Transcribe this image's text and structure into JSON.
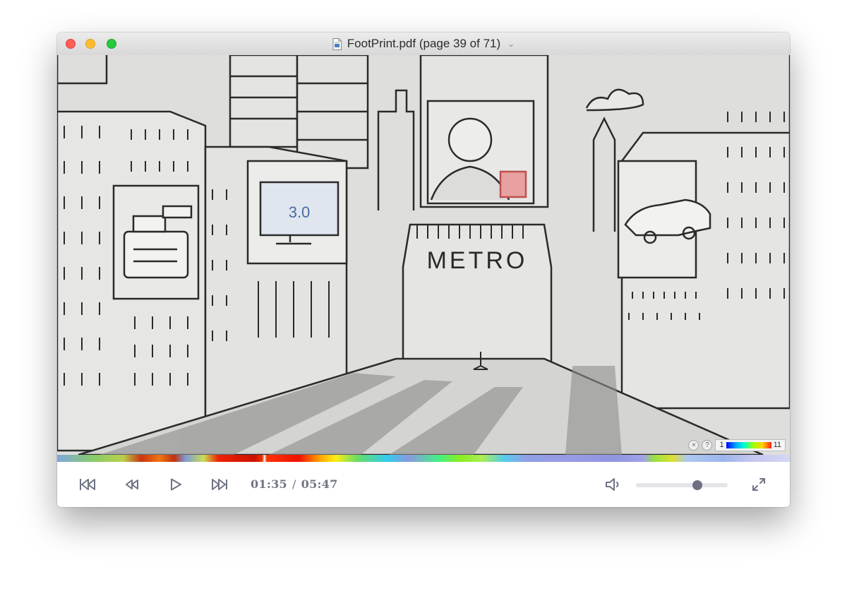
{
  "window": {
    "title": "FootPrint.pdf (page 39 of 71)"
  },
  "video": {
    "billboard_text": "3.0",
    "building_sign": "METRO",
    "heatmap_legend": {
      "min": "1",
      "max": "11",
      "close_symbol": "×",
      "help_symbol": "?"
    }
  },
  "controls": {
    "current_time": "01:35",
    "separator": "/",
    "total_time": "05:47",
    "volume_level": 0.67,
    "icons": [
      "skip-back-icon",
      "rewind-icon",
      "play-icon",
      "fast-forward-icon",
      "volume-icon",
      "fullscreen-icon"
    ]
  },
  "colors": {
    "controls_icon": "#6f7483",
    "accent_thumb": "#6c7080"
  }
}
